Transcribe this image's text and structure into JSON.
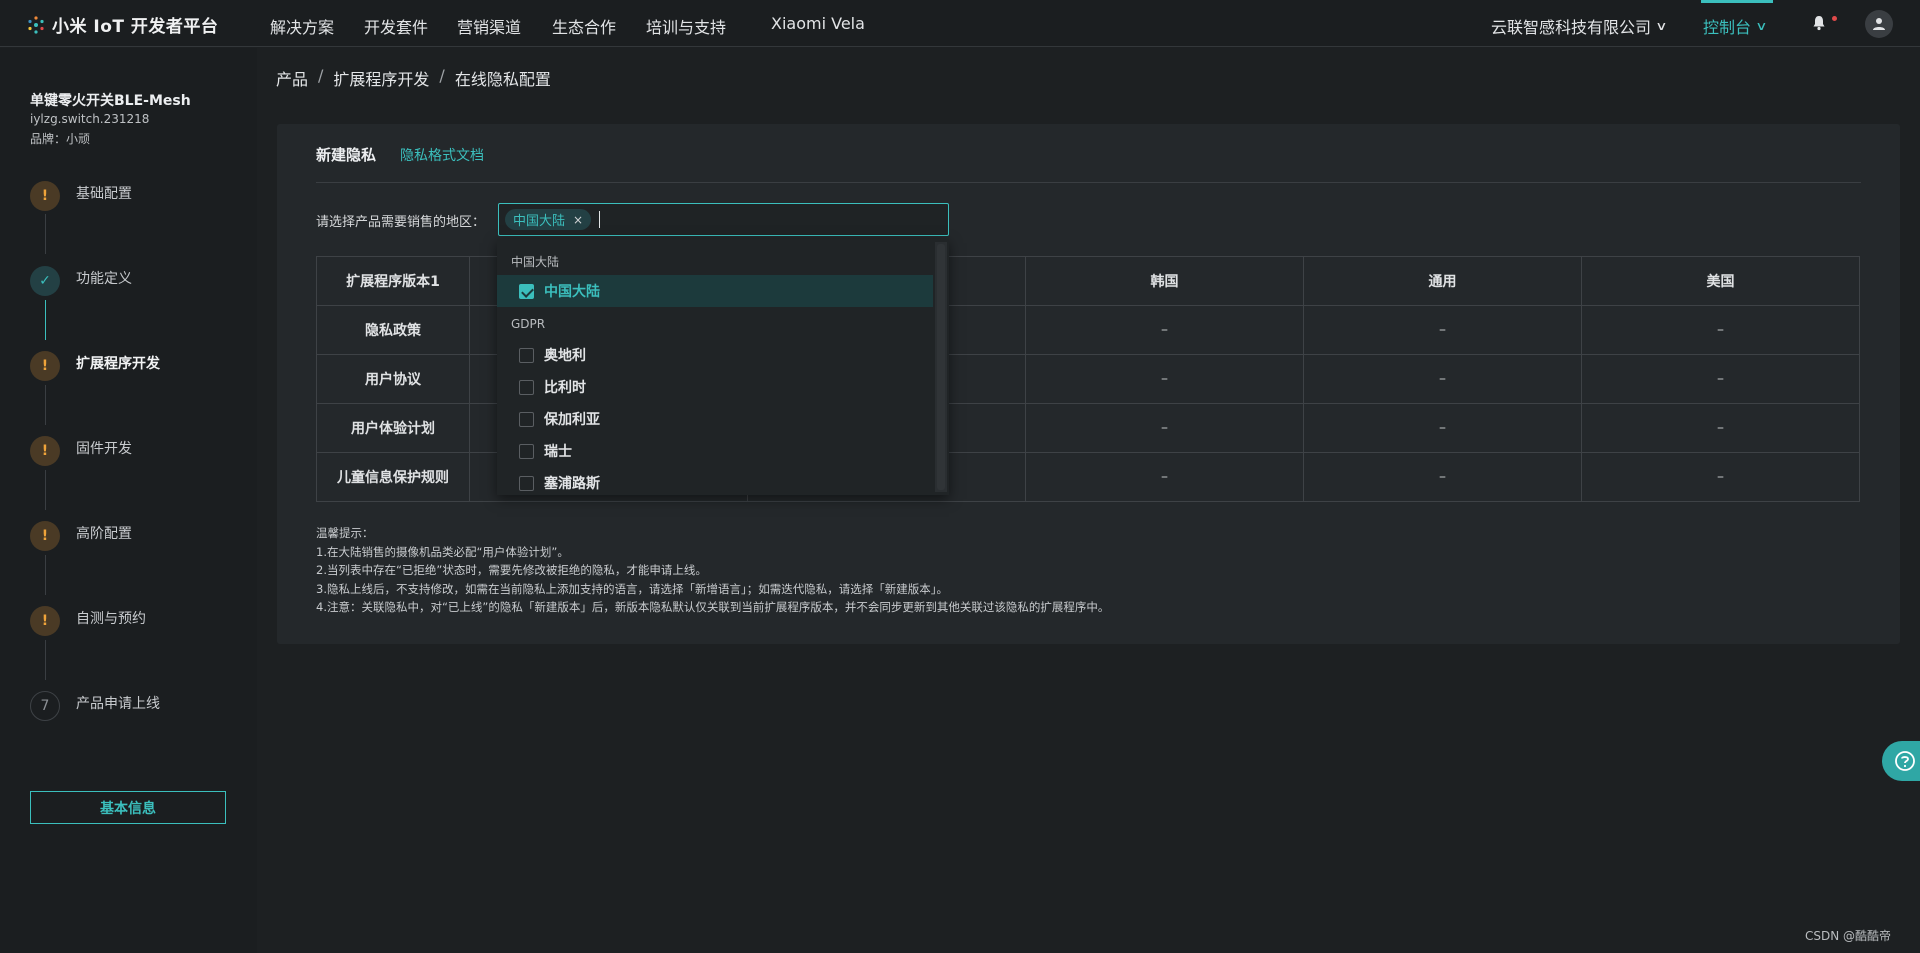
{
  "header": {
    "logo_text": "小米 IoT 开发者平台",
    "nav": [
      "解决方案",
      "开发套件",
      "营销渠道",
      "生态合作",
      "培训与支持",
      "Xiaomi Vela"
    ],
    "company": "云联智感科技有限公司",
    "console": "控制台"
  },
  "sidebar": {
    "product_name": "单键零火开关BLE-Mesh",
    "product_id": "iylzg.switch.231218",
    "brand": "品牌：小顽",
    "steps": [
      {
        "label": "基础配置",
        "state": "warning",
        "mark": "!"
      },
      {
        "label": "功能定义",
        "state": "done",
        "mark": "✓"
      },
      {
        "label": "扩展程序开发",
        "state": "warning",
        "mark": "!"
      },
      {
        "label": "固件开发",
        "state": "warning",
        "mark": "!"
      },
      {
        "label": "高阶配置",
        "state": "warning",
        "mark": "!"
      },
      {
        "label": "自测与预约",
        "state": "warning",
        "mark": "!"
      },
      {
        "label": "产品申请上线",
        "state": "pending",
        "mark": "7"
      }
    ],
    "basic_info_button": "基本信息"
  },
  "breadcrumb": [
    "产品",
    "扩展程序开发",
    "在线隐私配置"
  ],
  "card": {
    "title": "新建隐私",
    "doc_link": "隐私格式文档",
    "region_label": "请选择产品需要销售的地区：",
    "selected_tag": "中国大陆",
    "table": {
      "version_header": "扩展程序版本1",
      "columns": [
        "",
        "",
        "韩国",
        "通用",
        "美国"
      ],
      "rows": [
        {
          "name": "隐私政策",
          "cells": [
            "",
            "",
            "–",
            "–",
            "–"
          ]
        },
        {
          "name": "用户协议",
          "cells": [
            "",
            "",
            "–",
            "–",
            "–"
          ]
        },
        {
          "name": "用户体验计划",
          "cells": [
            "",
            "",
            "–",
            "–",
            "–"
          ]
        },
        {
          "name": "儿童信息保护规则",
          "cells": [
            "",
            "",
            "–",
            "–",
            "–"
          ]
        }
      ]
    },
    "tips": [
      "温馨提示：",
      "1.在大陆销售的摄像机品类必配“用户体验计划”。",
      "2.当列表中存在“已拒绝”状态时，需要先修改被拒绝的隐私，才能申请上线。",
      "3.隐私上线后，不支持修改，如需在当前隐私上添加支持的语言，请选择「新增语言」；如需迭代隐私，请选择「新建版本」。",
      "4.注意：关联隐私中，对“已上线”的隐私「新建版本」后，新版本隐私默认仅关联到当前扩展程序版本，并不会同步更新到其他关联过该隐私的扩展程序中。"
    ]
  },
  "dropdown": {
    "groups": [
      {
        "title": "中国大陆",
        "items": [
          {
            "label": "中国大陆",
            "checked": true
          }
        ]
      },
      {
        "title": "GDPR",
        "items": [
          {
            "label": "奥地利",
            "checked": false
          },
          {
            "label": "比利时",
            "checked": false
          },
          {
            "label": "保加利亚",
            "checked": false
          },
          {
            "label": "瑞士",
            "checked": false
          },
          {
            "label": "塞浦路斯",
            "checked": false
          }
        ]
      }
    ]
  },
  "watermark": "CSDN @酷酷帝",
  "colors": {
    "accent": "#3bbfbd",
    "warning": "#f0a43a",
    "background": "#1d2022"
  }
}
